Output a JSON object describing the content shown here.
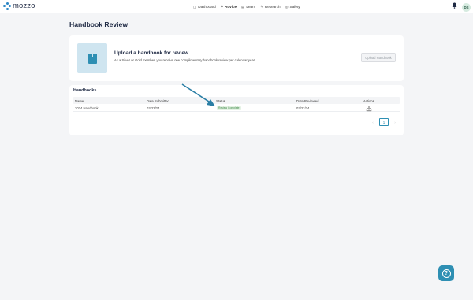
{
  "app": {
    "brand": "mozzo"
  },
  "nav": {
    "items": [
      {
        "label": "Dashboard",
        "icon": "calendar-icon",
        "glyph": "◫",
        "active": false
      },
      {
        "label": "Advice",
        "icon": "search-icon",
        "glyph": "⚲",
        "active": true
      },
      {
        "label": "Learn",
        "icon": "book-icon",
        "glyph": "▤",
        "active": false
      },
      {
        "label": "Research",
        "icon": "wrench-icon",
        "glyph": "✎",
        "active": false
      },
      {
        "label": "Safety",
        "icon": "safety-icon",
        "glyph": "◎",
        "active": false
      }
    ]
  },
  "user": {
    "initials": "DS"
  },
  "page": {
    "title": "Handbook Review"
  },
  "upload": {
    "title": "Upload a handbook for review",
    "subtitle": "As a Silver or Gold member, you receive one complimentary handbook review per calendar year.",
    "button_label": "Upload Handbook"
  },
  "handbooks": {
    "title": "Handbooks",
    "columns": [
      "Name",
      "Date Submitted",
      "Status",
      "Date Reviewed",
      "Actions"
    ],
    "rows": [
      {
        "name": "2024 Handbook",
        "date_submitted": "03/22/24",
        "status": "Review Complete",
        "date_reviewed": "03/22/24"
      }
    ],
    "pagination": {
      "prev": "‹",
      "current": "1",
      "next": "›"
    }
  },
  "help": {
    "glyph": "?"
  },
  "colors": {
    "accent": "#2e8fb3",
    "brand": "#1f2a44",
    "status_complete_bg": "#e4f2e4",
    "status_complete_text": "#3f8a47",
    "annotation_arrow": "#2a7ea5"
  }
}
